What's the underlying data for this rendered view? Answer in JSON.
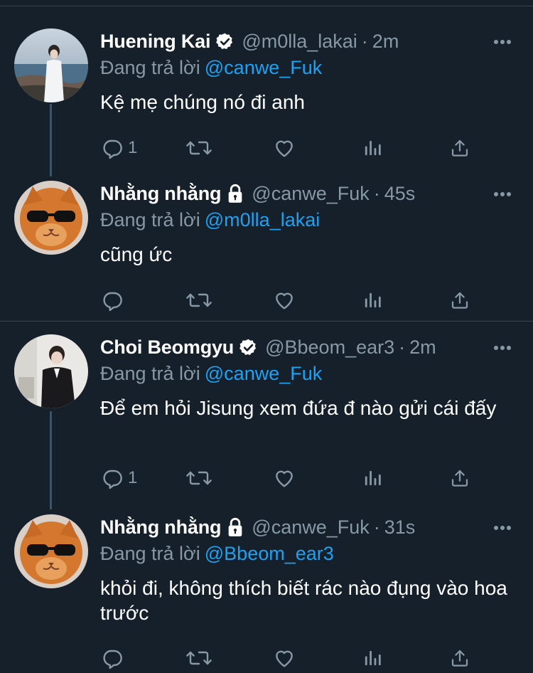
{
  "tweets": [
    {
      "name": "Huening Kai",
      "badge": "verified-icon",
      "handle": "@m0lla_lakai",
      "separator": "·",
      "time": "2m",
      "reply_prefix": "Đang trả lời",
      "reply_to": "@canwe_Fuk",
      "text": "Kệ mẹ chúng nó đi anh",
      "reply_count": "1",
      "avatar": "photo-person-beach"
    },
    {
      "name": "Nhằng nhằng",
      "badge": "lock-icon",
      "handle": "@canwe_Fuk",
      "separator": "·",
      "time": "45s",
      "reply_prefix": "Đang trả lời",
      "reply_to": "@m0lla_lakai",
      "text": "cũng ức",
      "reply_count": "",
      "avatar": "photo-cat-sunglasses"
    },
    {
      "name": "Choi Beomgyu",
      "badge": "verified-icon",
      "handle": "@Bbeom_ear3",
      "separator": "·",
      "time": "2m",
      "reply_prefix": "Đang trả lời",
      "reply_to": "@canwe_Fuk",
      "text": "Để em hỏi Jisung xem đứa đ nào gửi cái đấy",
      "reply_count": "1",
      "avatar": "photo-person-suit"
    },
    {
      "name": "Nhằng nhằng",
      "badge": "lock-icon",
      "handle": "@canwe_Fuk",
      "separator": "·",
      "time": "31s",
      "reply_prefix": "Đang trả lời",
      "reply_to": "@Bbeom_ear3",
      "text": "khỏi đi, không thích biết rác nào đụng vào hoa trước",
      "reply_count": "",
      "avatar": "photo-cat-sunglasses"
    }
  ],
  "icons": {
    "reply": "reply-icon",
    "retweet": "retweet-icon",
    "like": "like-icon",
    "analytics": "analytics-icon",
    "share": "share-icon",
    "more": "more-icon"
  },
  "colors": {
    "background": "#15202b",
    "border": "#38444d",
    "thread_line": "#3d5466",
    "primary_text": "#ffffff",
    "secondary_text": "#8899a6",
    "accent": "#1da1f2"
  }
}
